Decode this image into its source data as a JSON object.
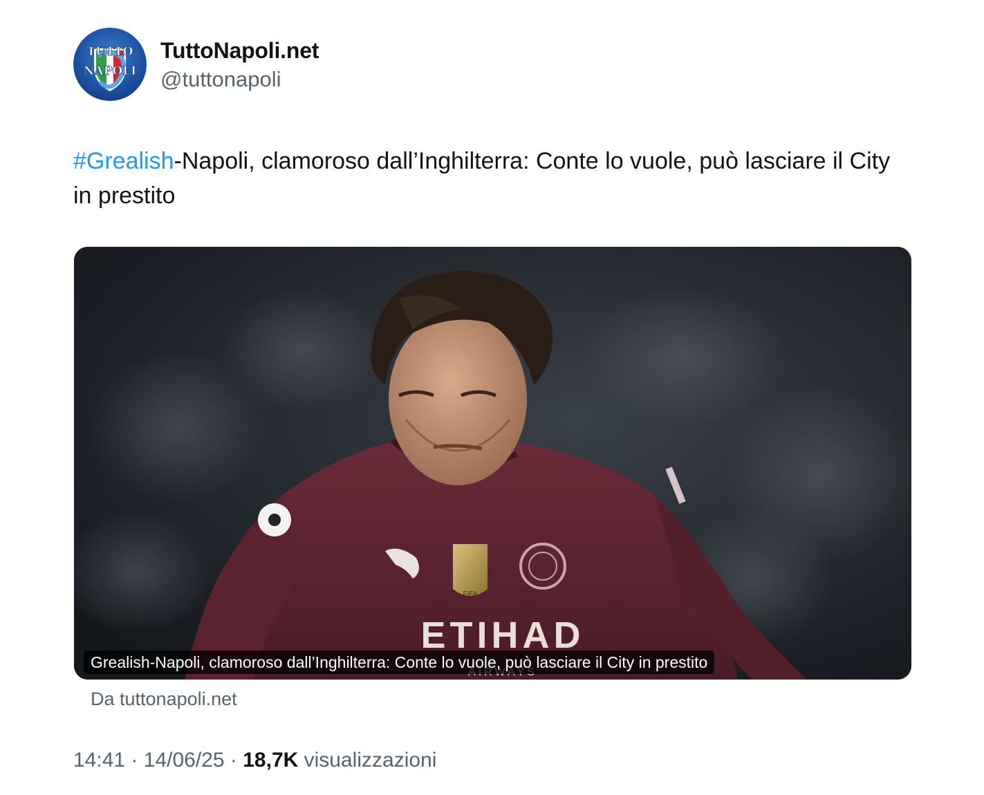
{
  "author": {
    "display_name": "TuttoNapoli.net",
    "handle": "@tuttonapoli",
    "avatar_logo_text_top": "TUTTO",
    "avatar_logo_text_bottom": "NAPOLI"
  },
  "tweet": {
    "hashtag": "#Grealish",
    "text_after_hashtag": "-Napoli, clamoroso dall’Inghilterra: Conte lo vuole, può lasciare il City in prestito"
  },
  "card": {
    "caption": "Grealish-Napoli, clamoroso dall’Inghilterra: Conte lo vuole, può lasciare il City in prestito",
    "source": "Da tuttonapoli.net",
    "shirt_sponsor_text": "ETIHAD",
    "shirt_sponsor_subtext": "AIRWAYS",
    "badge_text": "FIFA"
  },
  "meta": {
    "time": "14:41",
    "separator": "·",
    "date": "14/06/25",
    "views_count": "18,7K",
    "views_label": "visualizzazioni"
  },
  "colors": {
    "text": "#0f1419",
    "secondary": "#536471",
    "link": "#1d9bf0",
    "shirt": "#5a2430"
  }
}
